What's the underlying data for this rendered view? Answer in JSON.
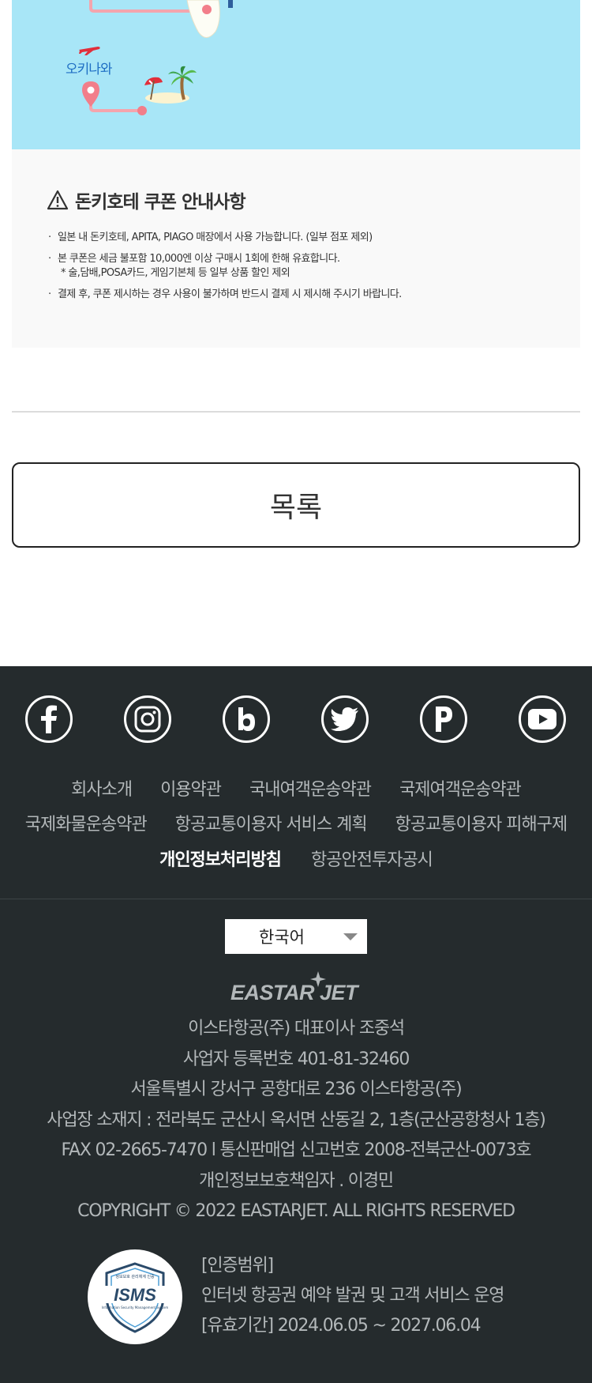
{
  "banner": {
    "destination_label": "오키나와",
    "icons": [
      "airplane-icon",
      "map-pin-icon",
      "palm-tree-icon",
      "beach-umbrella-icon"
    ]
  },
  "notice": {
    "title": "돈키호테 쿠폰 안내사항",
    "items": [
      {
        "text": "일본 내 돈키호테, APITA, PIAGO 매장에서 사용 가능합니다. (일부 점포 제외)",
        "sub": ""
      },
      {
        "text": "본 쿠폰은 세금 불포함 10,000엔 이상 구매시 1회에 한해 유효합니다.",
        "sub": "* 술,담배,POSA카드, 게임기본체 등 일부 상품 할인 제외"
      },
      {
        "text": "결제 후, 쿠폰 제시하는 경우 사용이 불가하며 반드시 결제 시 제시해 주시기 바랍니다.",
        "sub": ""
      }
    ]
  },
  "list_button": "목록",
  "footer": {
    "sns": [
      "facebook-icon",
      "instagram-icon",
      "blog-icon",
      "twitter-icon",
      "post-icon",
      "youtube-icon"
    ],
    "links_row1": [
      "회사소개",
      "이용약관",
      "국내여객운송약관",
      "국제여객운송약관"
    ],
    "links_row2": [
      "국제화물운송약관",
      "항공교통이용자 서비스 계획",
      "항공교통이용자 피해구제"
    ],
    "links_row3": [
      "개인정보처리방침",
      "항공안전투자공시"
    ],
    "language": "한국어",
    "logo_text": "EASTAR JET",
    "company_info": [
      "이스타항공(주) 대표이사 조중석",
      "사업자 등록번호 401-81-32460",
      "서울특별시 강서구 공항대로 236 이스타항공(주)",
      "사업장 소재지 : 전라북도 군산시 옥서면 산동길 2, 1층(군산공항청사 1층)",
      "FAX 02-2665-7470 l 통신판매업 신고번호 2008-전북군산-0073호",
      "개인정보보호책임자 . 이경민",
      "COPYRIGHT © 2022 EASTARJET. ALL RIGHTS RESERVED"
    ],
    "isms": {
      "badge_text": "ISMS",
      "badge_top": "정보보호 관리체계 인증",
      "badge_bottom": "Information Security Management System",
      "scope_label": "[인증범위]",
      "scope": "인터넷 항공권 예약 발권 및 고객 서비스 운영",
      "validity": "[유효기간] 2024.06.05 ~ 2027.06.04"
    }
  },
  "colors": {
    "banner_bg": "#a8e6f7",
    "footer_bg": "#252b2d",
    "footer_text": "#b3b8ba",
    "okinawa_label": "#1f6fc4"
  }
}
